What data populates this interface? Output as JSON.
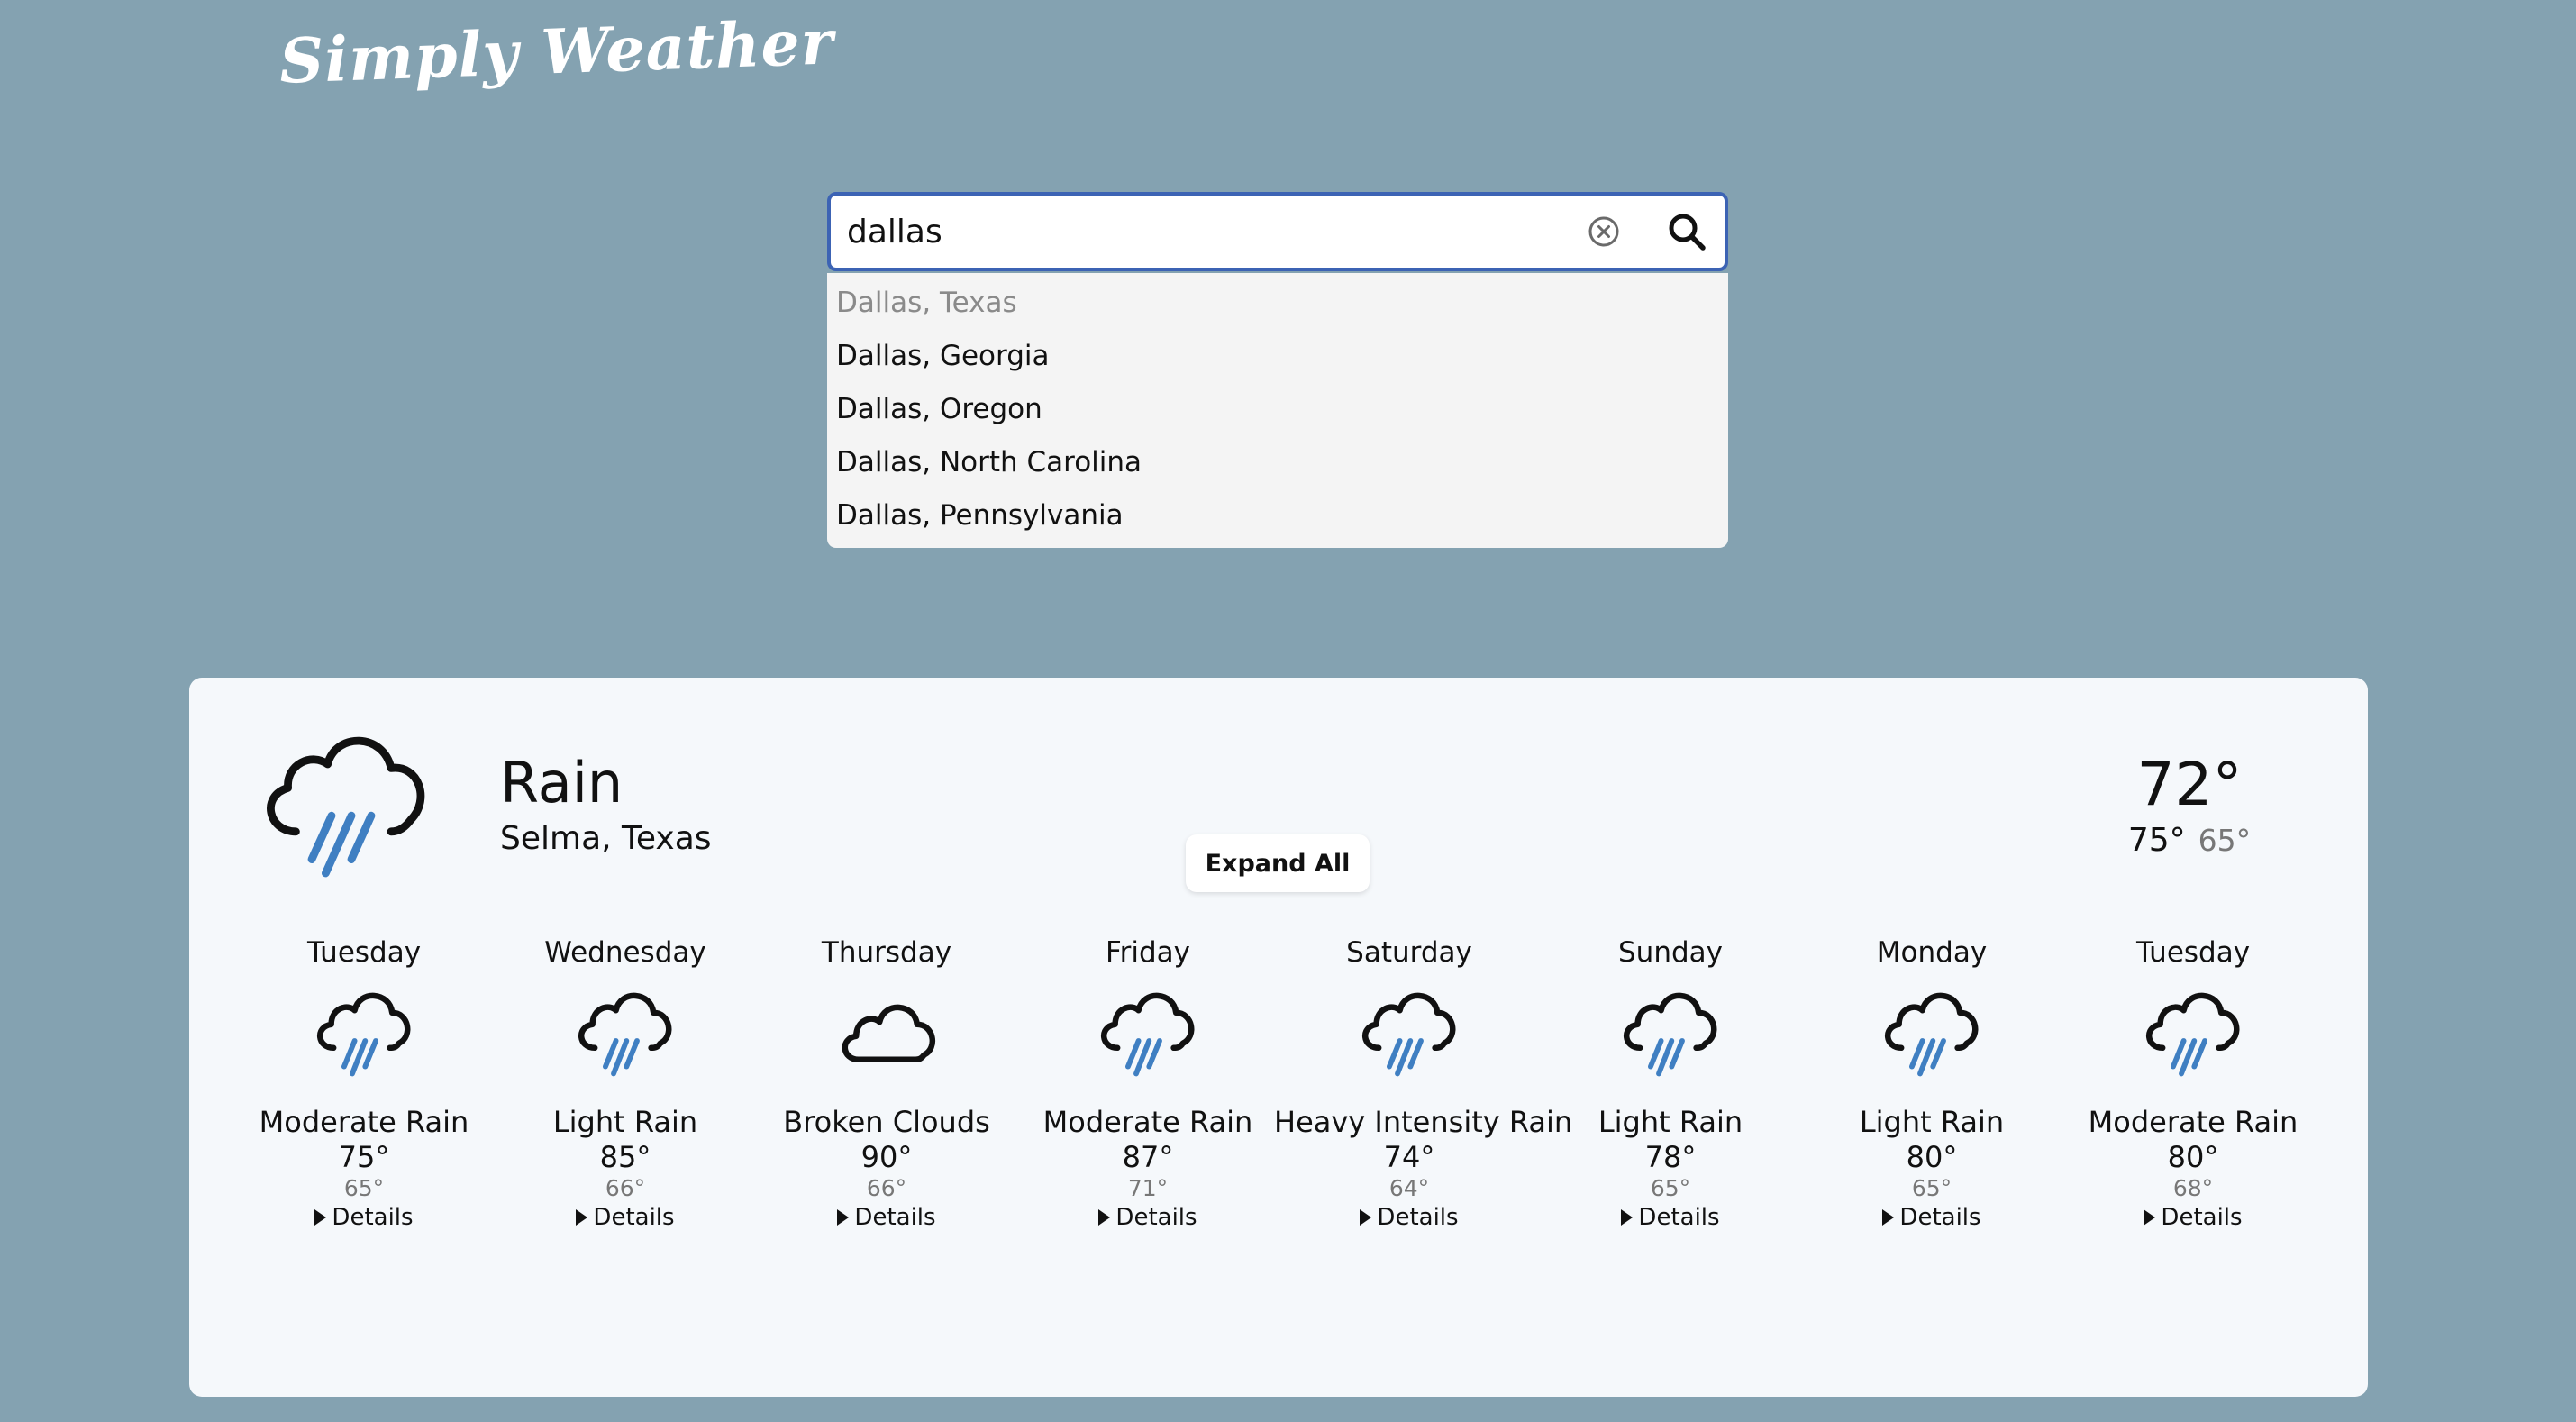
{
  "app": {
    "title": "Simply Weather"
  },
  "colors": {
    "background": "#84a2b1",
    "card": "#f5f8fb",
    "search_border": "#3c63b4",
    "rain": "#3f7fc2"
  },
  "search": {
    "value": "dallas",
    "placeholder": "",
    "clear_icon": "clear-circle-x-icon",
    "search_icon": "magnifier-icon",
    "suggestions": [
      "Dallas, Texas",
      "Dallas, Georgia",
      "Dallas, Oregon",
      "Dallas, North Carolina",
      "Dallas, Pennsylvania"
    ],
    "highlighted_index": 0
  },
  "current": {
    "condition": "Rain",
    "icon": "rain-cloud-icon",
    "location": "Selma, Texas",
    "temp": "72°",
    "high": "75°",
    "low": "65°"
  },
  "expand_all_label": "Expand All",
  "forecast": [
    {
      "day": "Tuesday",
      "icon": "rain-cloud-icon",
      "desc": "Moderate Rain",
      "hi": "75°",
      "lo": "65°",
      "details": "Details"
    },
    {
      "day": "Wednesday",
      "icon": "rain-cloud-icon",
      "desc": "Light Rain",
      "hi": "85°",
      "lo": "66°",
      "details": "Details"
    },
    {
      "day": "Thursday",
      "icon": "cloud-icon",
      "desc": "Broken Clouds",
      "hi": "90°",
      "lo": "66°",
      "details": "Details"
    },
    {
      "day": "Friday",
      "icon": "rain-cloud-icon",
      "desc": "Moderate Rain",
      "hi": "87°",
      "lo": "71°",
      "details": "Details"
    },
    {
      "day": "Saturday",
      "icon": "rain-cloud-icon",
      "desc": "Heavy Intensity Rain",
      "hi": "74°",
      "lo": "64°",
      "details": "Details"
    },
    {
      "day": "Sunday",
      "icon": "rain-cloud-icon",
      "desc": "Light Rain",
      "hi": "78°",
      "lo": "65°",
      "details": "Details"
    },
    {
      "day": "Monday",
      "icon": "rain-cloud-icon",
      "desc": "Light Rain",
      "hi": "80°",
      "lo": "65°",
      "details": "Details"
    },
    {
      "day": "Tuesday",
      "icon": "rain-cloud-icon",
      "desc": "Moderate Rain",
      "hi": "80°",
      "lo": "68°",
      "details": "Details"
    }
  ]
}
